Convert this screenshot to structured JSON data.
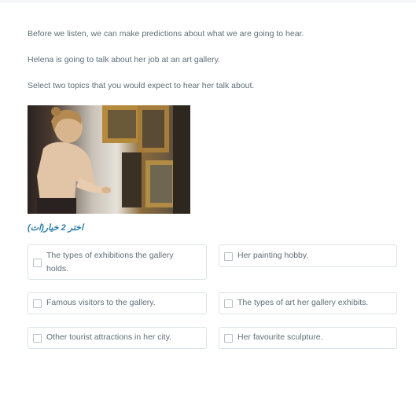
{
  "intro": {
    "line1": "Before we listen, we can make predictions about what we are going to hear.",
    "line2": "Helena is going to talk about her job at an art gallery.",
    "line3": "Select two topics that you would expect to hear her talk about."
  },
  "image": {
    "alt": "Young woman looking at paintings in an art gallery"
  },
  "instruction": "اختر 2 خيار(ات)",
  "options": [
    {
      "label": "The types of exhibitions the gallery holds.",
      "checked": false
    },
    {
      "label": "Her painting hobby.",
      "checked": false
    },
    {
      "label": "Famous visitors to the gallery.",
      "checked": false
    },
    {
      "label": "The types of art her gallery exhibits.",
      "checked": false
    },
    {
      "label": "Other tourist attractions in her city.",
      "checked": false
    },
    {
      "label": "Her favourite sculpture.",
      "checked": false
    }
  ]
}
